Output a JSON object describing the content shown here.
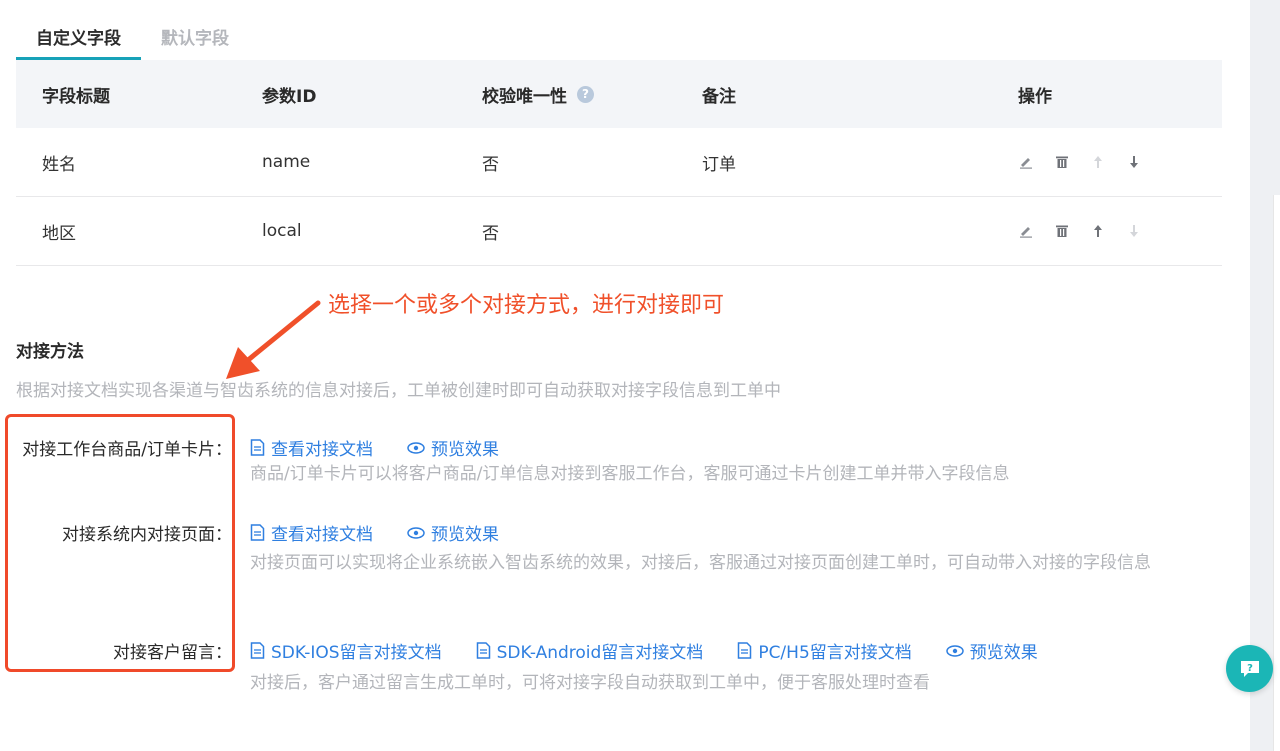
{
  "tabs": [
    {
      "label": "自定义字段",
      "active": true
    },
    {
      "label": "默认字段",
      "active": false
    }
  ],
  "table": {
    "headers": [
      "字段标题",
      "参数ID",
      "校验唯一性",
      "备注",
      "操作"
    ],
    "rows": [
      {
        "title": "姓名",
        "param": "name",
        "unique": "否",
        "note": "订单"
      },
      {
        "title": "地区",
        "param": "local",
        "unique": "否",
        "note": ""
      }
    ]
  },
  "callout": "选择一个或多个对接方式，进行对接即可",
  "section": {
    "title": "对接方法",
    "desc": "根据对接文档实现各渠道与智齿系统的信息对接后，工单被创建时即可自动获取对接字段信息到工单中"
  },
  "methods": [
    {
      "label": "对接工作台商品/订单卡片：",
      "links": [
        "查看对接文档",
        "预览效果"
      ],
      "desc": "商品/订单卡片可以将客户商品/订单信息对接到客服工作台，客服可通过卡片创建工单并带入字段信息"
    },
    {
      "label": "对接系统内对接页面：",
      "links": [
        "查看对接文档",
        "预览效果"
      ],
      "desc": "对接页面可以实现将企业系统嵌入智齿系统的效果，对接后，客服通过对接页面创建工单时，可自动带入对接的字段信息"
    },
    {
      "label": "对接客户留言：",
      "links": [
        "SDK-IOS留言对接文档",
        "SDK-Android留言对接文档",
        "PC/H5留言对接文档",
        "预览效果"
      ],
      "desc": "对接后，客户通过留言生成工单时，可将对接字段自动获取到工单中，便于客服处理时查看"
    }
  ],
  "colors": {
    "accent": "#17a2b8",
    "link": "#2f7fe0",
    "callout": "#f0502a"
  }
}
